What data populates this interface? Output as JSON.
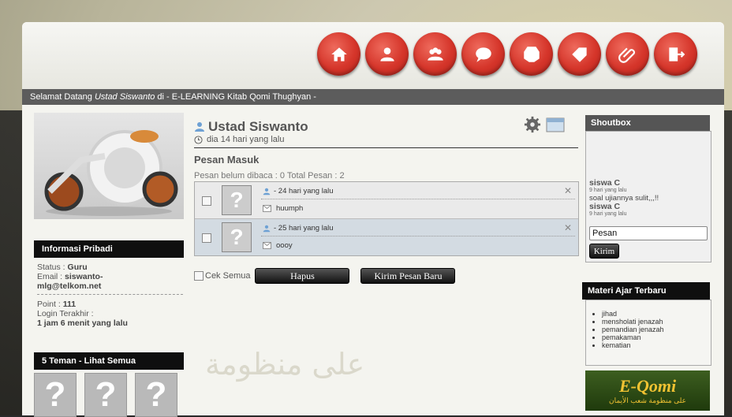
{
  "nav": {
    "buttons": [
      "home-icon",
      "users-icon",
      "group-icon",
      "chat-icon",
      "material-icon",
      "tag-icon",
      "attachment-icon",
      "logout-icon"
    ]
  },
  "welcome": {
    "prefix": "Selamat Datang ",
    "user": "Ustad Siswanto",
    "suffix": " di - E-LEARNING Kitab Qomi Thughyan -"
  },
  "profile": {
    "name": "Ustad Siswanto",
    "last_seen": "dia 14 hari yang lalu"
  },
  "info_pribadi": {
    "heading": "Informasi Pribadi",
    "status_label": "Status : ",
    "status_value": "Guru",
    "email_label": "Email : ",
    "email_value_1": "siswanto-",
    "email_value_2": "mlg@telkom.net",
    "point_label": "Point : ",
    "point_value": "111",
    "login_label": "Login Terakhir :",
    "login_value": "1 jam 6 menit yang lalu"
  },
  "friends": {
    "heading": "5 Teman - Lihat Semua",
    "placeholder": "?"
  },
  "pesan": {
    "title": "Pesan Masuk",
    "counts": "Pesan belum dibaca : 0   Total Pesan : 2",
    "messages": [
      {
        "from": " - 24 hari yang lalu",
        "body": "huumph"
      },
      {
        "from": " - 25 hari yang lalu",
        "body": "oooy"
      }
    ],
    "avatar": "?",
    "delete_glyph": "✕",
    "check_all": "Cek Semua",
    "delete_button": "Hapus",
    "new_button": "Kirim Pesan Baru"
  },
  "shoutbox": {
    "heading": "Shoutbox",
    "entries": [
      {
        "name": "siswa C",
        "time": "9 hari yang lalu",
        "text": "soal ujiannya sulit,,,!!"
      },
      {
        "name": "siswa C",
        "time": "9 hari yang lalu",
        "text": ""
      }
    ],
    "input_value": "Pesan",
    "send_label": "Kirim"
  },
  "materi": {
    "heading": "Materi Ajar Terbaru",
    "items": [
      "jihad",
      "mensholati jenazah",
      "pemandian jenazah",
      "pemakaman",
      "kematian"
    ]
  },
  "logo": {
    "title": "E-Qomi",
    "subtitle": "على منظومة شعب الأيمان"
  },
  "background_text": "على منظومة",
  "colors": {
    "nav_button": "#d5352a",
    "welcome_bar": "#5c5c5c",
    "side_heading": "#0f0f0f"
  }
}
